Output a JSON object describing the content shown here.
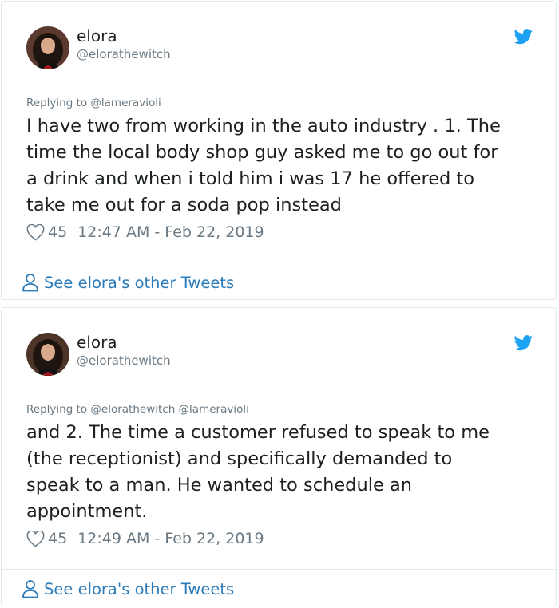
{
  "colors": {
    "link": "#2b7bb9",
    "twitter_blue": "#1da1f2",
    "muted": "#697882",
    "text": "#1c2022",
    "border": "#e1e8ed"
  },
  "tweets": [
    {
      "name": "elora",
      "handle": "@elorathewitch",
      "replying": "Replying to @lameravioli",
      "text": "I have two from working in the auto industry . 1. The\ntime the local body shop guy asked me to go out for\na drink and when i told him i was 17 he offered to\ntake me out for a soda pop instead",
      "likes": "45",
      "timestamp": "12:47 AM - Feb 22, 2019",
      "see_more": "See elora's other Tweets",
      "icons": [
        "avatar",
        "twitter-bird-icon",
        "heart-icon",
        "person-icon"
      ]
    },
    {
      "name": "elora",
      "handle": "@elorathewitch",
      "replying": "Replying to @elorathewitch @lameravioli",
      "text": "and 2. The time a customer refused to speak to me\n(the receptionist) and specifically demanded to\nspeak to a man. He wanted to schedule an\nappointment.",
      "likes": "45",
      "timestamp": "12:49 AM - Feb 22, 2019",
      "see_more": "See elora's other Tweets",
      "icons": [
        "avatar",
        "twitter-bird-icon",
        "heart-icon",
        "person-icon"
      ]
    }
  ]
}
